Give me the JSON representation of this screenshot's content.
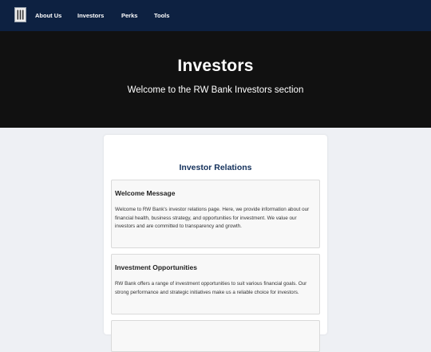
{
  "nav": {
    "logo_icon": "bank-building-icon",
    "links": [
      "About Us",
      "Investors",
      "Perks",
      "Tools"
    ]
  },
  "hero": {
    "title": "Investors",
    "subtitle": "Welcome to the RW Bank Investors section"
  },
  "main": {
    "title": "Investor Relations",
    "sections": [
      {
        "heading": "Welcome Message",
        "body": "Welcome to RW Bank's investor relations page. Here, we provide information about our financial health, business strategy, and opportunities for investment. We value our investors and are committed to transparency and growth."
      },
      {
        "heading": "Investment Opportunities",
        "body": "RW Bank offers a range of investment opportunities to suit various financial goals. Our strong performance and strategic initiatives make us a reliable choice for investors."
      }
    ]
  },
  "colors": {
    "navbar": "#0d2141",
    "hero": "#111111",
    "accent": "#13305b",
    "page_bg": "#eef0f4"
  }
}
